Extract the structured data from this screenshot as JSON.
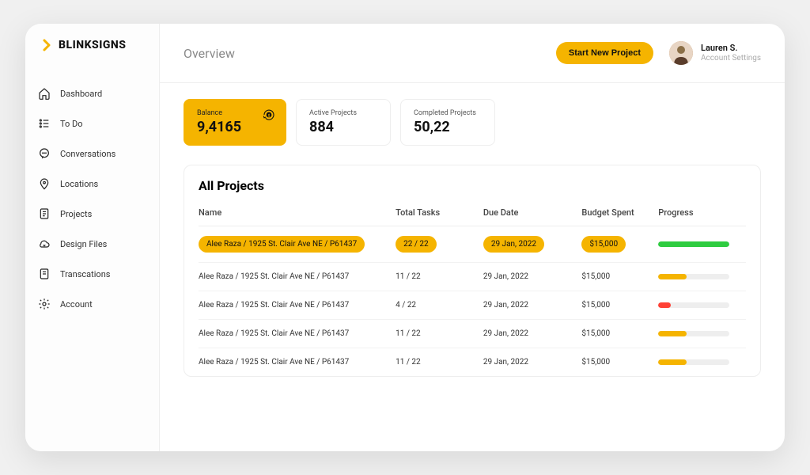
{
  "brand": "BLINKSIGNS",
  "sidebar": {
    "items": [
      {
        "label": "Dashboard",
        "icon": "home-icon"
      },
      {
        "label": "To Do",
        "icon": "list-icon"
      },
      {
        "label": "Conversations",
        "icon": "chat-icon"
      },
      {
        "label": "Locations",
        "icon": "pin-icon"
      },
      {
        "label": "Projects",
        "icon": "doc-icon"
      },
      {
        "label": "Design Files",
        "icon": "cloud-icon"
      },
      {
        "label": "Transcations",
        "icon": "receipt-icon"
      },
      {
        "label": "Account",
        "icon": "gear-icon"
      }
    ]
  },
  "header": {
    "title": "Overview",
    "start_btn": "Start New Project",
    "profile": {
      "name": "Lauren S.",
      "sub": "Account Settings"
    }
  },
  "stats": {
    "balance": {
      "label": "Balance",
      "value": "9,4165"
    },
    "active": {
      "label": "Active Projects",
      "value": "884"
    },
    "completed": {
      "label": "Completed Projects",
      "value": "50,22"
    }
  },
  "projects": {
    "title": "All Projects",
    "columns": {
      "name": "Name",
      "tasks": "Total Tasks",
      "due": "Due Date",
      "budget": "Budget Spent",
      "progress": "Progress"
    },
    "rows": [
      {
        "name": "Alee Raza / 1925 St. Clair Ave NE / P61437",
        "tasks": "22 / 22",
        "due": "29 Jan, 2022",
        "budget": "$15,000",
        "progress_pct": 100,
        "color": "#2ecc40",
        "highlight": true
      },
      {
        "name": "Alee Raza / 1925 St. Clair Ave NE / P61437",
        "tasks": "11 / 22",
        "due": "29 Jan, 2022",
        "budget": "$15,000",
        "progress_pct": 40,
        "color": "#f5b400",
        "highlight": false
      },
      {
        "name": "Alee Raza / 1925 St. Clair Ave NE / P61437",
        "tasks": "4 / 22",
        "due": "29 Jan, 2022",
        "budget": "$15,000",
        "progress_pct": 18,
        "color": "#ff4136",
        "highlight": false
      },
      {
        "name": "Alee Raza / 1925 St. Clair Ave NE / P61437",
        "tasks": "11 / 22",
        "due": "29 Jan, 2022",
        "budget": "$15,000",
        "progress_pct": 40,
        "color": "#f5b400",
        "highlight": false
      },
      {
        "name": "Alee Raza / 1925 St. Clair Ave NE / P61437",
        "tasks": "11 / 22",
        "due": "29 Jan, 2022",
        "budget": "$15,000",
        "progress_pct": 40,
        "color": "#f5b400",
        "highlight": false
      }
    ]
  },
  "colors": {
    "accent": "#f5b400"
  }
}
